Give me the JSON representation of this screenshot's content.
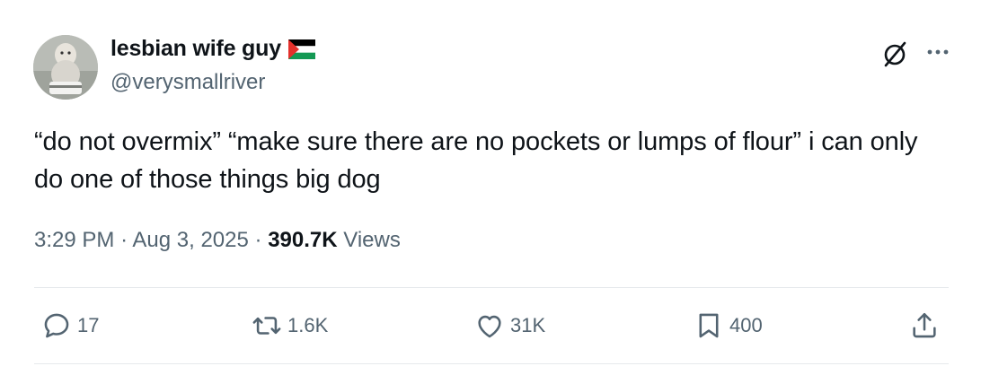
{
  "author": {
    "display_name": "lesbian wife guy",
    "handle": "@verysmallriver",
    "flag_icon": "palestine-flag-icon"
  },
  "tweet": {
    "text": "“do not overmix” “make sure there are no pockets or lumps of flour” i can only do one of those things big dog",
    "time": "3:29 PM",
    "date": "Aug 3, 2025",
    "views_count": "390.7K",
    "views_label": "Views"
  },
  "actions": {
    "replies": "17",
    "reposts": "1.6K",
    "likes": "31K",
    "bookmarks": "400"
  },
  "colors": {
    "text": "#0f1419",
    "secondary": "#536471",
    "divider": "#e6e9ec"
  }
}
